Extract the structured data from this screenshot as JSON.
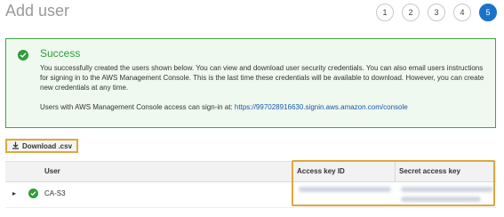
{
  "header": {
    "title": "Add user"
  },
  "steps": [
    {
      "label": "1"
    },
    {
      "label": "2"
    },
    {
      "label": "3"
    },
    {
      "label": "4"
    },
    {
      "label": "5",
      "active": true
    }
  ],
  "success": {
    "title": "Success",
    "message": "You successfully created the users shown below. You can view and download user security credentials. You can also email users instructions for signing in to the AWS Management Console. This is the last time these credentials will be available to download. However, you can create new credentials at any time.",
    "signin_prefix": "Users with AWS Management Console access can sign-in at:",
    "signin_url": "https://997028916630.signin.aws.amazon.com/console"
  },
  "download": {
    "label": "Download .csv"
  },
  "table": {
    "columns": {
      "user": "User",
      "access_key_id": "Access key ID",
      "secret_access_key": "Secret access key"
    },
    "rows": [
      {
        "user": "CA-S3"
      }
    ]
  },
  "colors": {
    "accent": "#1a73c8",
    "success": "#2e9d3a",
    "highlight": "#e0a73a"
  },
  "icons": [
    "success-check-icon",
    "download-icon",
    "expand-arrow-icon"
  ]
}
